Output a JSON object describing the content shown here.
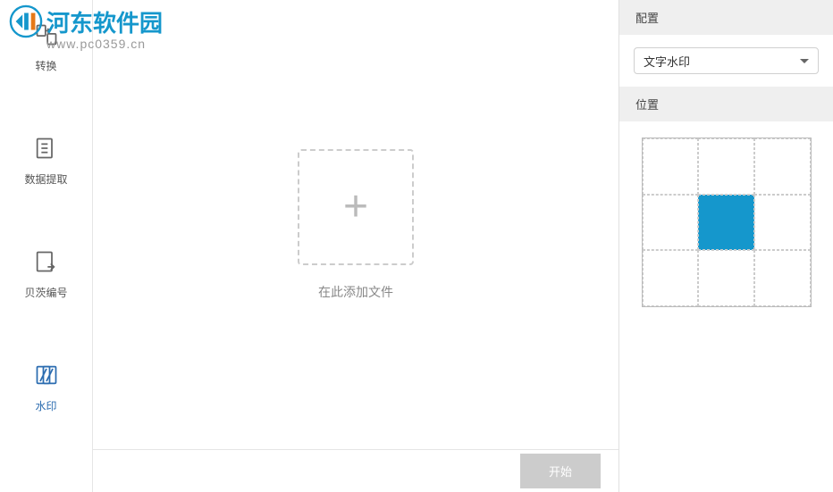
{
  "watermark": {
    "brand_text": "河东软件园",
    "url": "www.pc0359.cn"
  },
  "sidebar": {
    "items": [
      {
        "label": "转换",
        "icon": "convert",
        "active": false
      },
      {
        "label": "数据提取",
        "icon": "extract",
        "active": false
      },
      {
        "label": "贝茨编号",
        "icon": "bates",
        "active": false
      },
      {
        "label": "水印",
        "icon": "watermark",
        "active": true
      }
    ]
  },
  "main": {
    "drop_text": "在此添加文件",
    "start_button": "开始"
  },
  "right_panel": {
    "config": {
      "header": "配置",
      "dropdown_selected": "文字水印"
    },
    "position": {
      "header": "位置",
      "selected_index": 4
    }
  }
}
